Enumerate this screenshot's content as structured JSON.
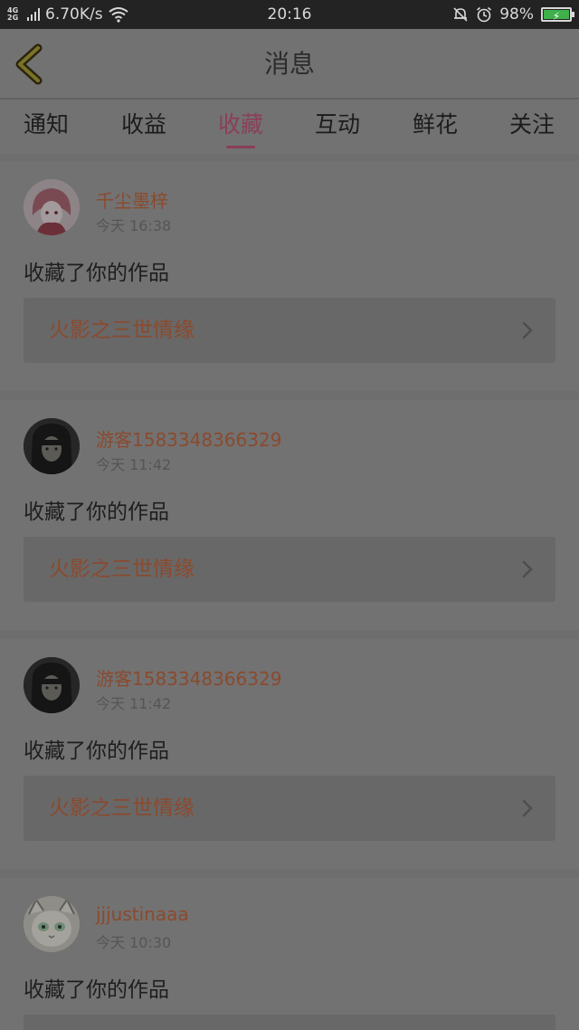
{
  "status_bar": {
    "network": "4G 2G",
    "speed": "6.70K/s",
    "time": "20:16",
    "battery": "98%"
  },
  "header": {
    "title": "消息"
  },
  "tabs": [
    {
      "label": "通知"
    },
    {
      "label": "收益"
    },
    {
      "label": "收藏"
    },
    {
      "label": "互动"
    },
    {
      "label": "鲜花"
    },
    {
      "label": "关注"
    }
  ],
  "active_tab": "收藏",
  "messages": [
    {
      "user": "千尘墨梓",
      "time": "今天 16:38",
      "action": "收藏了你的作品",
      "work": "火影之三世情缘"
    },
    {
      "user": "游客1583348366329",
      "time": "今天 11:42",
      "action": "收藏了你的作品",
      "work": "火影之三世情缘"
    },
    {
      "user": "游客1583348366329",
      "time": "今天 11:42",
      "action": "收藏了你的作品",
      "work": "火影之三世情缘"
    },
    {
      "user": "jjjustinaaa",
      "time": "今天 10:30",
      "action": "收藏了你的作品",
      "work": ""
    }
  ],
  "colors": {
    "accent": "#8a3f57",
    "username": "#8a4a2e",
    "overlay_bg": "#727272"
  }
}
